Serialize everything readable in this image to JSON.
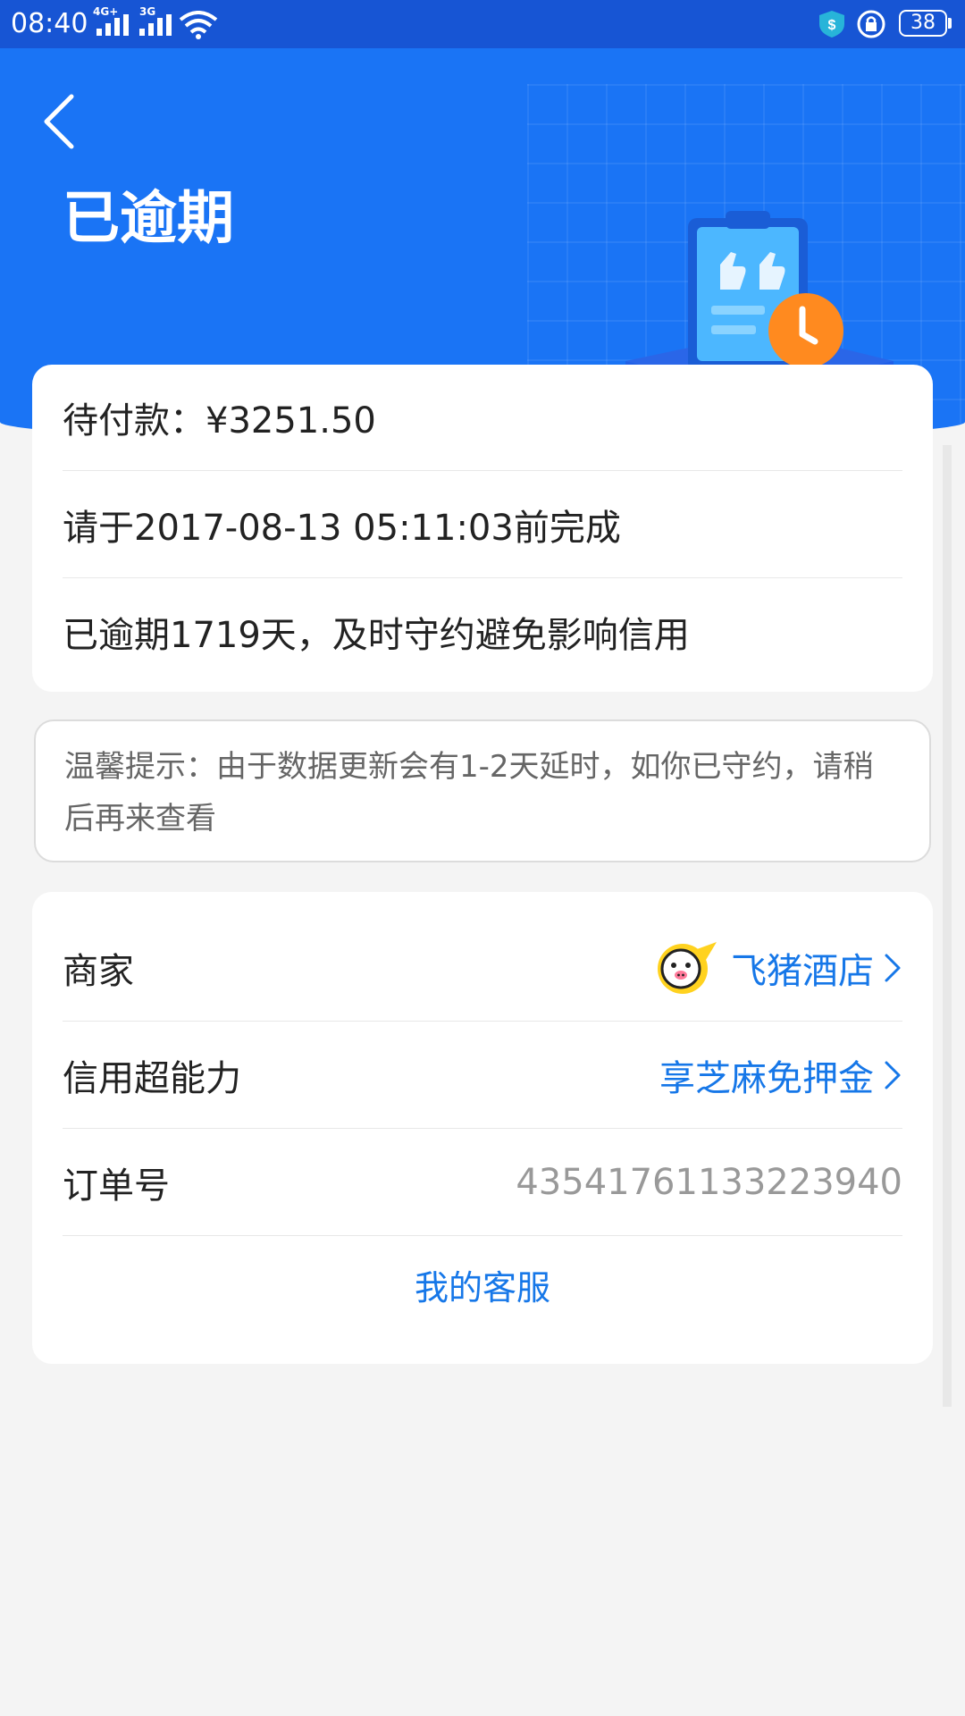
{
  "status_bar": {
    "time": "08:40",
    "network_1": "4G+",
    "network_2": "3G",
    "battery": "38"
  },
  "header": {
    "title": "已逾期"
  },
  "payment": {
    "amount_line": "待付款：¥3251.50",
    "deadline_line": "请于2017-08-13 05:11:03前完成",
    "overdue_line": "已逾期1719天，及时守约避免影响信用"
  },
  "notice": {
    "text": "温馨提示：由于数据更新会有1-2天延时，如你已守约，请稍后再来查看"
  },
  "details": {
    "merchant_label": "商家",
    "merchant_value": "飞猪酒店",
    "credit_label": "信用超能力",
    "credit_value": "享芝麻免押金",
    "order_label": "订单号",
    "order_value": "43541761133223940",
    "service_link": "我的客服"
  },
  "colors": {
    "header_blue": "#1a74f5",
    "status_blue": "#1755d4",
    "link_blue": "#1677e8",
    "alert_orange": "#ff8a1f"
  }
}
